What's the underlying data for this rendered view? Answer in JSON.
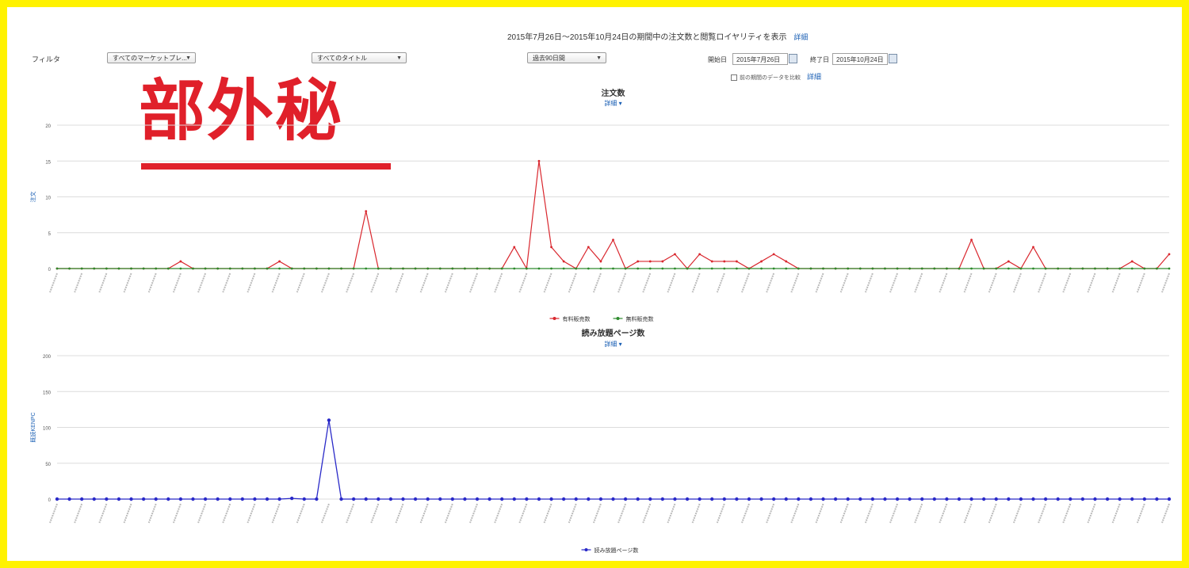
{
  "header": {
    "title": "2015年7月26日〜2015年10月24日の期間中の注文数と閲覧ロイヤリティを表示",
    "details_link": "詳細"
  },
  "filters": {
    "label": "フィルタ",
    "select1": "すべてのマーケットプレ...",
    "select2": "すべてのタイトル",
    "select3": "過去90日間",
    "start_label": "開始日",
    "start_date": "2015年7月26日",
    "end_label": "終了日",
    "end_date": "2015年10月24日",
    "compare_note": "前の期間のデータを比較",
    "compare_link": "詳細"
  },
  "stamp": {
    "text": "部外秘"
  },
  "colors": {
    "series_red": "#d9272e",
    "series_green": "#2e8b2e",
    "series_blue": "#2929c8",
    "frame": "#fff200",
    "stamp": "#e0202a"
  },
  "chart_data": [
    {
      "type": "line",
      "title": "注文数",
      "subtitle": "詳細",
      "ylabel": "注文",
      "ylim": [
        0,
        20
      ],
      "yticks": [
        0,
        5,
        10,
        15,
        20
      ],
      "x_count": 91,
      "series": [
        {
          "name": "有料販売数",
          "color": "#d9272e",
          "values": [
            0,
            0,
            0,
            0,
            0,
            0,
            0,
            0,
            0,
            0,
            1,
            0,
            0,
            0,
            0,
            0,
            0,
            0,
            1,
            0,
            0,
            0,
            0,
            0,
            0,
            8,
            0,
            0,
            0,
            0,
            0,
            0,
            0,
            0,
            0,
            0,
            0,
            3,
            0,
            15,
            3,
            1,
            0,
            3,
            1,
            4,
            0,
            1,
            1,
            1,
            2,
            0,
            2,
            1,
            1,
            1,
            0,
            1,
            2,
            1,
            0,
            0,
            0,
            0,
            0,
            0,
            0,
            0,
            0,
            0,
            0,
            0,
            0,
            0,
            4,
            0,
            0,
            1,
            0,
            3,
            0,
            0,
            0,
            0,
            0,
            0,
            0,
            1,
            0,
            0,
            2
          ]
        },
        {
          "name": "無料販売数",
          "color": "#2e8b2e",
          "values": [
            0,
            0,
            0,
            0,
            0,
            0,
            0,
            0,
            0,
            0,
            0,
            0,
            0,
            0,
            0,
            0,
            0,
            0,
            0,
            0,
            0,
            0,
            0,
            0,
            0,
            0,
            0,
            0,
            0,
            0,
            0,
            0,
            0,
            0,
            0,
            0,
            0,
            0,
            0,
            0,
            0,
            0,
            0,
            0,
            0,
            0,
            0,
            0,
            0,
            0,
            0,
            0,
            0,
            0,
            0,
            0,
            0,
            0,
            0,
            0,
            0,
            0,
            0,
            0,
            0,
            0,
            0,
            0,
            0,
            0,
            0,
            0,
            0,
            0,
            0,
            0,
            0,
            0,
            0,
            0,
            0,
            0,
            0,
            0,
            0,
            0,
            0,
            0,
            0,
            0,
            0
          ]
        }
      ]
    },
    {
      "type": "line",
      "title": "読み放題ページ数",
      "subtitle": "詳細",
      "ylabel": "既読KENPC",
      "ylim": [
        0,
        200
      ],
      "yticks": [
        0,
        50,
        100,
        150,
        200
      ],
      "x_count": 91,
      "series": [
        {
          "name": "読み放題ページ数",
          "color": "#2929c8",
          "values": [
            0,
            0,
            0,
            0,
            0,
            0,
            0,
            0,
            0,
            0,
            0,
            0,
            0,
            0,
            0,
            0,
            0,
            0,
            0,
            1,
            0,
            0,
            110,
            0,
            0,
            0,
            0,
            0,
            0,
            0,
            0,
            0,
            0,
            0,
            0,
            0,
            0,
            0,
            0,
            0,
            0,
            0,
            0,
            0,
            0,
            0,
            0,
            0,
            0,
            0,
            0,
            0,
            0,
            0,
            0,
            0,
            0,
            0,
            0,
            0,
            0,
            0,
            0,
            0,
            0,
            0,
            0,
            0,
            0,
            0,
            0,
            0,
            0,
            0,
            0,
            0,
            0,
            0,
            0,
            0,
            0,
            0,
            0,
            0,
            0,
            0,
            0,
            0,
            0,
            0,
            0
          ]
        }
      ]
    }
  ]
}
